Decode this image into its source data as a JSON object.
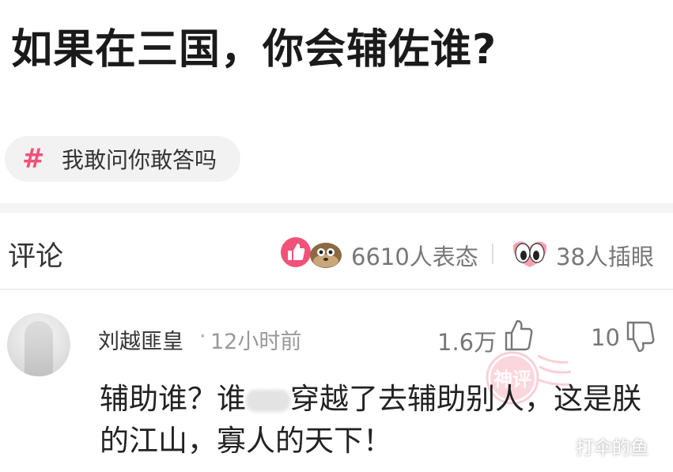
{
  "question": {
    "title": "如果在三国，你会辅佐谁?"
  },
  "topic": {
    "symbol": "#",
    "label": "我敢问你敢答吗"
  },
  "comments_header": {
    "title": "评论",
    "reactions_count": "6610人表态",
    "eyes_count": "38人插眼"
  },
  "comment": {
    "username": "刘越匪皇",
    "separator": "·",
    "time": "12小时前",
    "likes": "1.6万",
    "dislikes": "10",
    "text_part1": "辅助谁？谁",
    "text_part2": "穿越了去辅助别人，这是朕的江山，寡人的天下！",
    "stamp_text": "神评"
  },
  "watermark": "打伞的鱼",
  "colors": {
    "accent": "#f0527a",
    "stamp": "#f1798f"
  }
}
